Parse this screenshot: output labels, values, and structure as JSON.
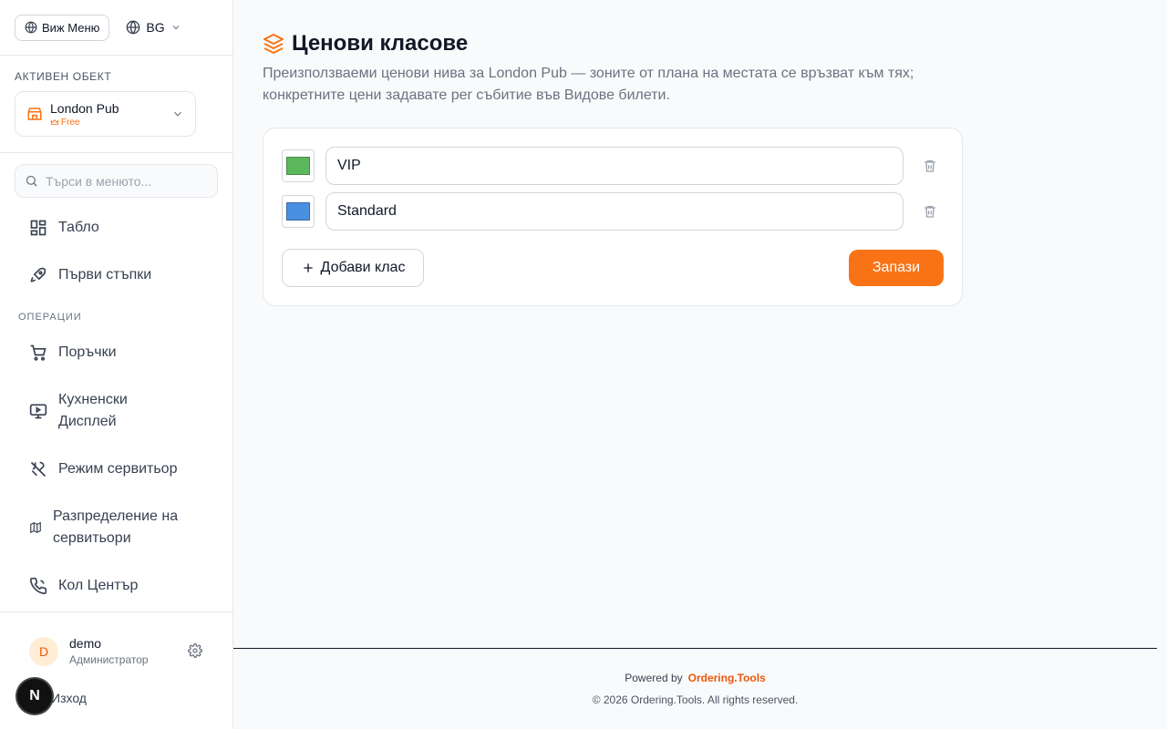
{
  "topbar": {
    "menu_button": "Виж Меню",
    "language": "BG"
  },
  "venue": {
    "section_label": "АКТИВЕН ОБЕКТ",
    "name": "London Pub",
    "plan": "Free"
  },
  "search": {
    "placeholder": "Търси в менюто..."
  },
  "nav": {
    "items_top": [
      {
        "label": "Табло",
        "icon": "dashboard-icon"
      },
      {
        "label": "Първи стъпки",
        "icon": "rocket-icon"
      }
    ],
    "operations_label": "ОПЕРАЦИИ",
    "items_ops": [
      {
        "label": "Поръчки",
        "icon": "cart-icon"
      },
      {
        "label": "Кухненски Дисплей",
        "icon": "monitor-icon"
      },
      {
        "label": "Режим сервитьор",
        "icon": "utensils-icon"
      },
      {
        "label": "Разпределение на сервитьори",
        "icon": "map-icon"
      },
      {
        "label": "Кол Център",
        "icon": "phone-icon"
      }
    ]
  },
  "user": {
    "initial": "D",
    "name": "demo",
    "role": "Администратор",
    "logout": "Изход",
    "badge": "N"
  },
  "page": {
    "title": "Ценови класове",
    "description": "Преизползваеми ценови нива за London Pub — зоните от плана на местата се връзват към тях; конкретните цени задавате per събитие във Видове билети."
  },
  "price_classes": [
    {
      "name": "VIP",
      "color": "#5cb85c"
    },
    {
      "name": "Standard",
      "color": "#4a8fe0"
    }
  ],
  "actions": {
    "add_label": "Добави клас",
    "save_label": "Запази"
  },
  "footer": {
    "powered_by": "Powered by",
    "brand": "Ordering.Tools",
    "copyright": "© 2026 Ordering.Tools. All rights reserved."
  },
  "colors": {
    "accent": "#f97316"
  }
}
